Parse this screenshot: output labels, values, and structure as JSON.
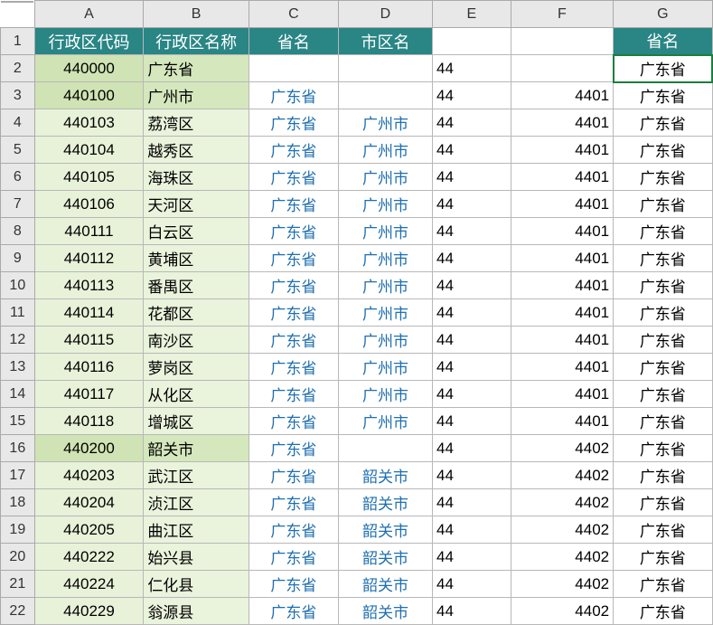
{
  "columns": [
    "A",
    "B",
    "C",
    "D",
    "E",
    "F",
    "G"
  ],
  "header_row": {
    "A": "行政区代码",
    "B": "行政区名称",
    "C": "省名",
    "D": "市区名",
    "E": "",
    "F": "",
    "G": "省名"
  },
  "selected_cell": "G2",
  "chart_data": {
    "type": "table",
    "rows": [
      {
        "num": 2,
        "A": "440000",
        "B": "广东省",
        "C": "",
        "D": "",
        "E": "44",
        "F": "",
        "G": "广东省",
        "hl": true
      },
      {
        "num": 3,
        "A": "440100",
        "B": "广州市",
        "C": "广东省",
        "D": "",
        "E": "44",
        "F": "4401",
        "G": "广东省",
        "hl": true
      },
      {
        "num": 4,
        "A": "440103",
        "B": "荔湾区",
        "C": "广东省",
        "D": "广州市",
        "E": "44",
        "F": "4401",
        "G": "广东省"
      },
      {
        "num": 5,
        "A": "440104",
        "B": "越秀区",
        "C": "广东省",
        "D": "广州市",
        "E": "44",
        "F": "4401",
        "G": "广东省"
      },
      {
        "num": 6,
        "A": "440105",
        "B": "海珠区",
        "C": "广东省",
        "D": "广州市",
        "E": "44",
        "F": "4401",
        "G": "广东省"
      },
      {
        "num": 7,
        "A": "440106",
        "B": "天河区",
        "C": "广东省",
        "D": "广州市",
        "E": "44",
        "F": "4401",
        "G": "广东省"
      },
      {
        "num": 8,
        "A": "440111",
        "B": "白云区",
        "C": "广东省",
        "D": "广州市",
        "E": "44",
        "F": "4401",
        "G": "广东省"
      },
      {
        "num": 9,
        "A": "440112",
        "B": "黄埔区",
        "C": "广东省",
        "D": "广州市",
        "E": "44",
        "F": "4401",
        "G": "广东省"
      },
      {
        "num": 10,
        "A": "440113",
        "B": "番禺区",
        "C": "广东省",
        "D": "广州市",
        "E": "44",
        "F": "4401",
        "G": "广东省"
      },
      {
        "num": 11,
        "A": "440114",
        "B": "花都区",
        "C": "广东省",
        "D": "广州市",
        "E": "44",
        "F": "4401",
        "G": "广东省"
      },
      {
        "num": 12,
        "A": "440115",
        "B": "南沙区",
        "C": "广东省",
        "D": "广州市",
        "E": "44",
        "F": "4401",
        "G": "广东省"
      },
      {
        "num": 13,
        "A": "440116",
        "B": "萝岗区",
        "C": "广东省",
        "D": "广州市",
        "E": "44",
        "F": "4401",
        "G": "广东省"
      },
      {
        "num": 14,
        "A": "440117",
        "B": "从化区",
        "C": "广东省",
        "D": "广州市",
        "E": "44",
        "F": "4401",
        "G": "广东省"
      },
      {
        "num": 15,
        "A": "440118",
        "B": "增城区",
        "C": "广东省",
        "D": "广州市",
        "E": "44",
        "F": "4401",
        "G": "广东省"
      },
      {
        "num": 16,
        "A": "440200",
        "B": "韶关市",
        "C": "广东省",
        "D": "",
        "E": "44",
        "F": "4402",
        "G": "广东省",
        "hl": true
      },
      {
        "num": 17,
        "A": "440203",
        "B": "武江区",
        "C": "广东省",
        "D": "韶关市",
        "E": "44",
        "F": "4402",
        "G": "广东省"
      },
      {
        "num": 18,
        "A": "440204",
        "B": "浈江区",
        "C": "广东省",
        "D": "韶关市",
        "E": "44",
        "F": "4402",
        "G": "广东省"
      },
      {
        "num": 19,
        "A": "440205",
        "B": "曲江区",
        "C": "广东省",
        "D": "韶关市",
        "E": "44",
        "F": "4402",
        "G": "广东省"
      },
      {
        "num": 20,
        "A": "440222",
        "B": "始兴县",
        "C": "广东省",
        "D": "韶关市",
        "E": "44",
        "F": "4402",
        "G": "广东省"
      },
      {
        "num": 21,
        "A": "440224",
        "B": "仁化县",
        "C": "广东省",
        "D": "韶关市",
        "E": "44",
        "F": "4402",
        "G": "广东省"
      },
      {
        "num": 22,
        "A": "440229",
        "B": "翁源县",
        "C": "广东省",
        "D": "韶关市",
        "E": "44",
        "F": "4402",
        "G": "广东省"
      }
    ]
  }
}
